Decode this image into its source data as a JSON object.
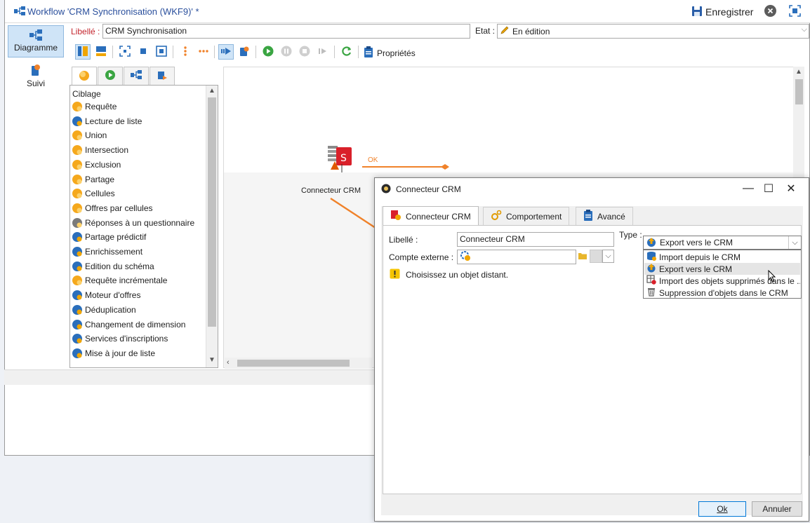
{
  "window": {
    "title": "Workflow 'CRM Synchronisation (WKF9)' *",
    "save_label": "Enregistrer"
  },
  "leftnav": {
    "items": [
      {
        "label": "Diagramme",
        "icon": "workflow-diagram-icon"
      },
      {
        "label": "Suivi",
        "icon": "tracking-icon"
      }
    ]
  },
  "form": {
    "label_caption": "Libellé :",
    "label_value": "CRM Synchronisation",
    "state_caption": "Etat :",
    "state_value": "En édition"
  },
  "toolbar": {
    "properties_label": "Propriétés"
  },
  "palette": {
    "tabs": [
      "targeting-tab",
      "flow-control-tab",
      "actions-tab",
      "events-tab"
    ],
    "section": "Ciblage",
    "items": [
      {
        "label": "Requête",
        "icon": "query-icon"
      },
      {
        "label": "Lecture de liste",
        "icon": "read-list-icon"
      },
      {
        "label": "Union",
        "icon": "union-icon"
      },
      {
        "label": "Intersection",
        "icon": "intersection-icon"
      },
      {
        "label": "Exclusion",
        "icon": "exclusion-icon"
      },
      {
        "label": "Partage",
        "icon": "split-icon"
      },
      {
        "label": "Cellules",
        "icon": "cells-icon"
      },
      {
        "label": "Offres par cellules",
        "icon": "offers-by-cell-icon"
      },
      {
        "label": "Réponses à un questionnaire",
        "icon": "survey-responses-icon"
      },
      {
        "label": "Partage prédictif",
        "icon": "predictive-split-icon"
      },
      {
        "label": "Enrichissement",
        "icon": "enrichment-icon"
      },
      {
        "label": "Edition du schéma",
        "icon": "schema-edit-icon"
      },
      {
        "label": "Requête incrémentale",
        "icon": "incremental-query-icon"
      },
      {
        "label": "Moteur d'offres",
        "icon": "offer-engine-icon"
      },
      {
        "label": "Déduplication",
        "icon": "deduplication-icon"
      },
      {
        "label": "Changement de dimension",
        "icon": "change-dimension-icon"
      },
      {
        "label": "Services d'inscriptions",
        "icon": "subscription-services-icon"
      },
      {
        "label": "Mise à jour de liste",
        "icon": "list-update-icon"
      }
    ]
  },
  "canvas": {
    "node_label": "Connecteur CRM",
    "transition_label": "OK"
  },
  "dialog": {
    "title": "Connecteur CRM",
    "tabs": [
      "Connecteur CRM",
      "Comportement",
      "Avancé"
    ],
    "label_caption": "Libellé :",
    "label_value": "Connecteur CRM",
    "account_caption": "Compte externe :",
    "account_value": "",
    "type_caption": "Type :",
    "type_value": "Export vers le CRM",
    "type_options": [
      "Import depuis le CRM",
      "Export vers le CRM",
      "Import des objets supprimés dans le ...",
      "Suppression d'objets dans le CRM"
    ],
    "warning": "Choisissez un objet distant.",
    "ok_label": "Ok",
    "cancel_label": "Annuler"
  },
  "colors": {
    "accent_blue": "#2a4f9c",
    "label_red": "#c4262e",
    "transition_orange": "#f0822a",
    "run_green": "#3aa542"
  }
}
